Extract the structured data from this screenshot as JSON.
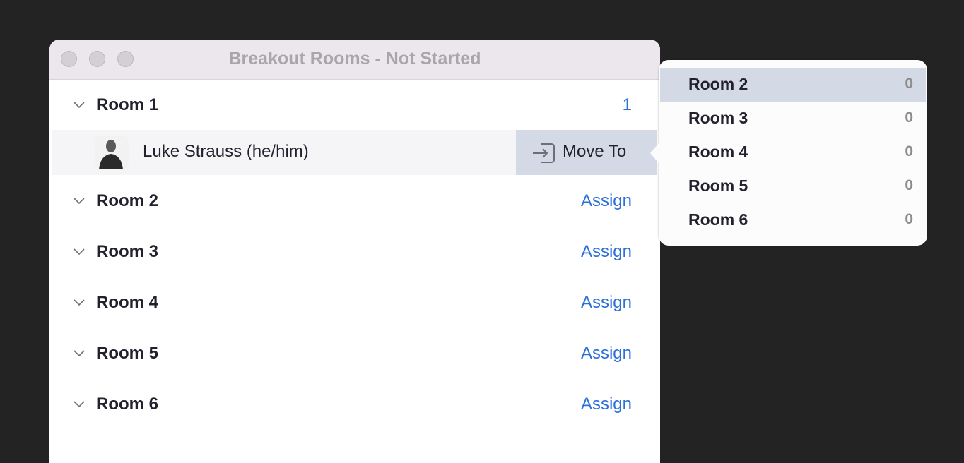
{
  "window": {
    "title": "Breakout Rooms - Not Started"
  },
  "rooms": [
    {
      "name": "Room 1",
      "count": "1",
      "expanded": true,
      "participants": [
        {
          "name": "Luke Strauss (he/him)",
          "action_label": "Move To"
        }
      ]
    },
    {
      "name": "Room 2",
      "action": "Assign"
    },
    {
      "name": "Room 3",
      "action": "Assign"
    },
    {
      "name": "Room 4",
      "action": "Assign"
    },
    {
      "name": "Room 5",
      "action": "Assign"
    },
    {
      "name": "Room 6",
      "action": "Assign"
    }
  ],
  "move_to_menu": {
    "items": [
      {
        "name": "Room 2",
        "count": "0",
        "selected": true
      },
      {
        "name": "Room 3",
        "count": "0"
      },
      {
        "name": "Room 4",
        "count": "0"
      },
      {
        "name": "Room 5",
        "count": "0"
      },
      {
        "name": "Room 6",
        "count": "0"
      }
    ]
  },
  "colors": {
    "accent": "#2d6fd9",
    "highlight": "#d3d9e5",
    "background": "#232323"
  }
}
